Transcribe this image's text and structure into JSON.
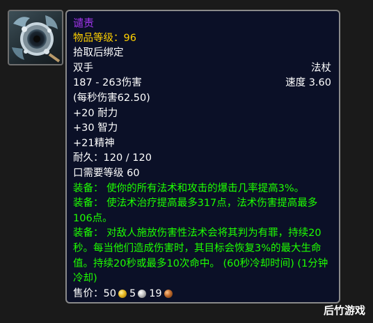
{
  "item": {
    "name": "谴责",
    "item_level": "物品等级：96",
    "bind": "拾取后绑定",
    "slot": "双手",
    "type": "法杖",
    "damage": "187 - 263伤害",
    "speed": "速度 3.60",
    "dps": "(每秒伤害62.50)",
    "stats": [
      "+20 耐力",
      "+30 智力",
      "+21精神"
    ],
    "durability": "耐久：120 / 120",
    "required_level": "口需要等级 60",
    "equip_effects": [
      "装备： 使你的所有法术和攻击的爆击几率提高3%。",
      "装备： 使法术治疗提高最多317点，法术伤害提高最多106点。",
      "装备： 对敌人施放伤害性法术会将其判为有罪，持续20秒。每当他们造成伤害时，其目标会恢复3%的最大生命值。持续20秒或最多10次命中。 (60秒冷却时间) (1分钟 冷却)"
    ],
    "sell_label": "售价：",
    "sell_gold": "50",
    "sell_silver": "5",
    "sell_copper": "19"
  },
  "colors": {
    "epic": "#a335ee",
    "item_level": "#ffd100",
    "equip": "#1eff00",
    "background": "#0b1027"
  },
  "icons": {
    "item_icon": "staff-orb-icon",
    "gold": "gold-coin-icon",
    "silver": "silver-coin-icon",
    "copper": "copper-coin-icon"
  },
  "watermark": "后竹游戏"
}
